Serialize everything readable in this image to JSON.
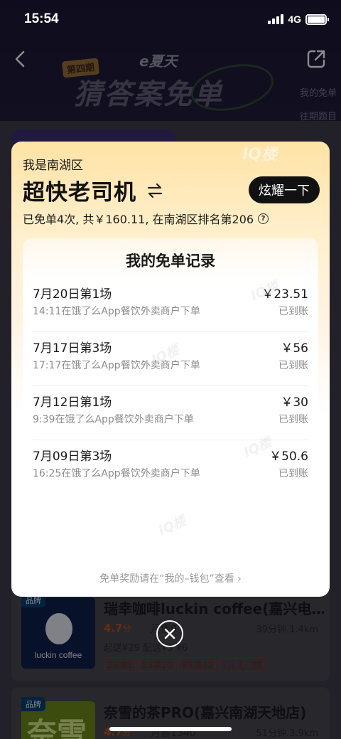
{
  "status_bar": {
    "time": "15:54",
    "network": "4G"
  },
  "banner": {
    "sub_brand": "e夏天",
    "period_badge": "第四期",
    "title": "猜答案免单",
    "links": [
      "我的免单",
      "往期题目"
    ]
  },
  "stores": [
    {
      "tag": "品牌",
      "logo_text": "luckin coffee",
      "name": "瑞幸咖啡luckin coffee(嘉兴电…",
      "rating": "4.7",
      "rating_unit": "分",
      "sales": "月售9",
      "eta": "39分钟 1.4km",
      "fee": "起送¥29 配送¥3 ¥6",
      "promos": [
        "29减8",
        "59减20",
        "99减40",
        "7元无门槛"
      ]
    },
    {
      "tag": "品牌",
      "logo_text": "奈雪",
      "name": "奈雪的茶PRO(嘉兴南湖天地店)",
      "rating": "4.7",
      "rating_unit": "分",
      "sales": "月售1340",
      "eta": "51分钟 3.9km"
    }
  ],
  "modal": {
    "watermark": "IQ楼",
    "region_label": "我是南湖区",
    "title": "超快老司机",
    "flex_button": "炫耀一下",
    "stats": "已免单4次, 共￥160.11, 在南湖区排名第206",
    "records_title": "我的免单记录",
    "records": [
      {
        "title": "7月20日第1场",
        "detail": "14:11在饿了么App餐饮外卖商户下单",
        "amount": "￥23.51",
        "status": "已到账"
      },
      {
        "title": "7月17日第3场",
        "detail": "17:17在饿了么App餐饮外卖商户下单",
        "amount": "￥56",
        "status": "已到账"
      },
      {
        "title": "7月12日第1场",
        "detail": "9:39在饿了么App餐饮外卖商户下单",
        "amount": "￥30",
        "status": "已到账"
      },
      {
        "title": "7月09日第3场",
        "detail": "16:25在饿了么App餐饮外卖商户下单",
        "amount": "￥50.6",
        "status": "已到账"
      }
    ],
    "wallet_tip": "免单奖励请在“我的–钱包”查看 ›"
  }
}
